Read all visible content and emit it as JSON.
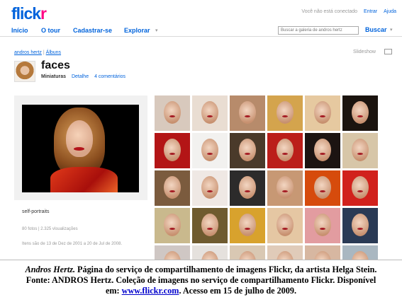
{
  "header": {
    "logo_part1": "flick",
    "logo_part2": "r",
    "status_text": "Você não está conectado",
    "login_link": "Entrar",
    "help_link": "Ajuda",
    "colors": {
      "brand_blue": "#0063dc",
      "brand_pink": "#ff0084"
    }
  },
  "nav": {
    "items": [
      "Início",
      "O tour",
      "Cadastrar-se",
      "Explorar"
    ],
    "search_placeholder": "Buscar a galeria de andros hertz",
    "search_button": "Buscar"
  },
  "breadcrumb": {
    "user": "andros hertz",
    "sep": "|",
    "albums": "Álbuns"
  },
  "slideshow_label": "Slideshow",
  "set": {
    "title": "faces",
    "views": [
      "Miniaturas",
      "Detalhe",
      "4 comentários"
    ],
    "description": "self-portraits",
    "stats": "80 fotos | 2.325 visualizações",
    "dates": "Itens são de 13 de Dez de 2001 a 20 de Jul de 2008."
  },
  "thumbnails": [
    {
      "bg": "#d8c9bd"
    },
    {
      "bg": "#e9ddd2"
    },
    {
      "bg": "#b78b6b"
    },
    {
      "bg": "#d4a44d"
    },
    {
      "bg": "#e6c9a0"
    },
    {
      "bg": "#1b140f"
    },
    {
      "bg": "#b31516"
    },
    {
      "bg": "#f2f1ef"
    },
    {
      "bg": "#4a3a2a"
    },
    {
      "bg": "#bb1e1a"
    },
    {
      "bg": "#1c1412"
    },
    {
      "bg": "#d7c6a8"
    },
    {
      "bg": "#7b5b3e"
    },
    {
      "bg": "#efe8e4"
    },
    {
      "bg": "#2c2b2b"
    },
    {
      "bg": "#c79874"
    },
    {
      "bg": "#d64b0c"
    },
    {
      "bg": "#d1211c"
    },
    {
      "bg": "#c9b98d"
    },
    {
      "bg": "#6f5b2f"
    },
    {
      "bg": "#d8a22d"
    },
    {
      "bg": "#e5c7a3"
    },
    {
      "bg": "#e29ca0"
    },
    {
      "bg": "#2a3a55"
    },
    {
      "bg": "#cfc7c4"
    },
    {
      "bg": "#e5e1dd"
    },
    {
      "bg": "#d9c8b3"
    },
    {
      "bg": "#e0cbb9"
    },
    {
      "bg": "#d7b7a1"
    },
    {
      "bg": "#a9b7c1"
    }
  ],
  "caption": {
    "author": "Andros Hertz.",
    "line1_rest": " Página do serviço de compartilhamento de imagens Flickr, da artista Helga Stein.",
    "line2": "Fonte: ANDROS Hertz. Coleção de imagens no serviço de compartilhamento Flickr. Disponível",
    "line3_pre": "em: ",
    "url": "www.flickr.com",
    "line3_post": ". Acesso em 15 de julho de 2009."
  }
}
